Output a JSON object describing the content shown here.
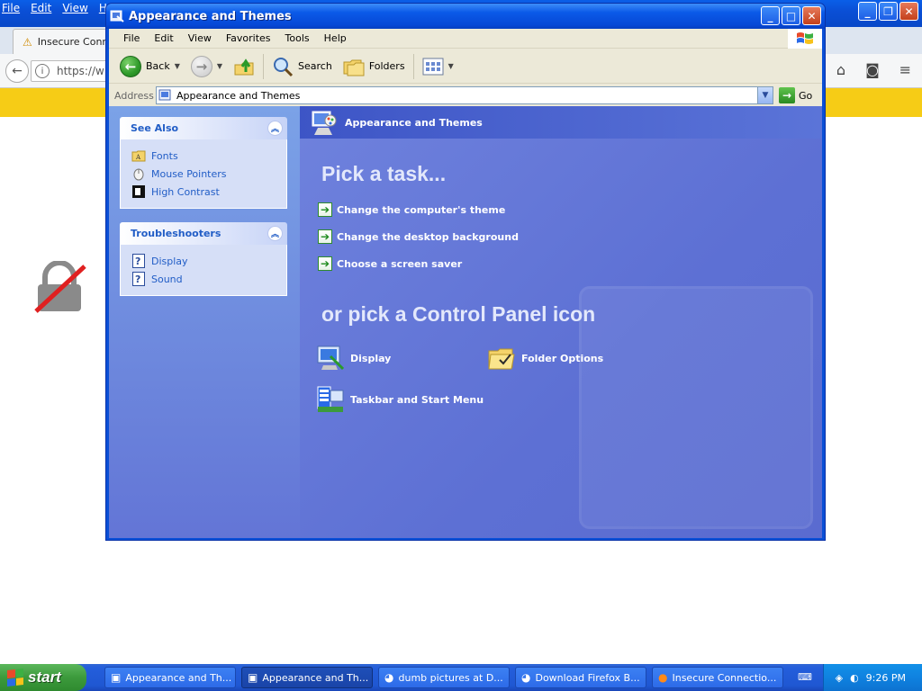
{
  "firefox": {
    "menu": [
      "File",
      "Edit",
      "View",
      "H"
    ],
    "tab_label": "Insecure Conne",
    "url_text": "https://w"
  },
  "window": {
    "title": "Appearance and Themes",
    "menu": [
      "File",
      "Edit",
      "View",
      "Favorites",
      "Tools",
      "Help"
    ],
    "toolbar": {
      "back": "Back",
      "search": "Search",
      "folders": "Folders"
    },
    "address": {
      "label": "Address",
      "value": "Appearance and Themes",
      "go": "Go"
    }
  },
  "taskpane": {
    "see_also": {
      "title": "See Also",
      "items": [
        "Fonts",
        "Mouse Pointers",
        "High Contrast"
      ]
    },
    "troubleshooters": {
      "title": "Troubleshooters",
      "items": [
        "Display",
        "Sound"
      ]
    }
  },
  "content": {
    "header": "Appearance and Themes",
    "pick_task": "Pick a task...",
    "tasks": [
      "Change the computer's theme",
      "Change the desktop background",
      "Choose a screen saver"
    ],
    "or_pick": "or pick a Control Panel icon",
    "icons": [
      "Display",
      "Folder Options",
      "Taskbar and Start Menu"
    ]
  },
  "taskbar": {
    "start": "start",
    "items": [
      "Appearance and Th...",
      "Appearance and Th...",
      "dumb pictures at D...",
      "Download Firefox B...",
      "Insecure Connectio..."
    ],
    "clock": "9:26 PM"
  },
  "colors": {
    "xp_title_blue": "#0a4fd6",
    "taskpane_link": "#215dc6",
    "content_bg": "#6375d6",
    "firefox_notice": "#f6cc16",
    "start_green": "#3c9a3c"
  }
}
